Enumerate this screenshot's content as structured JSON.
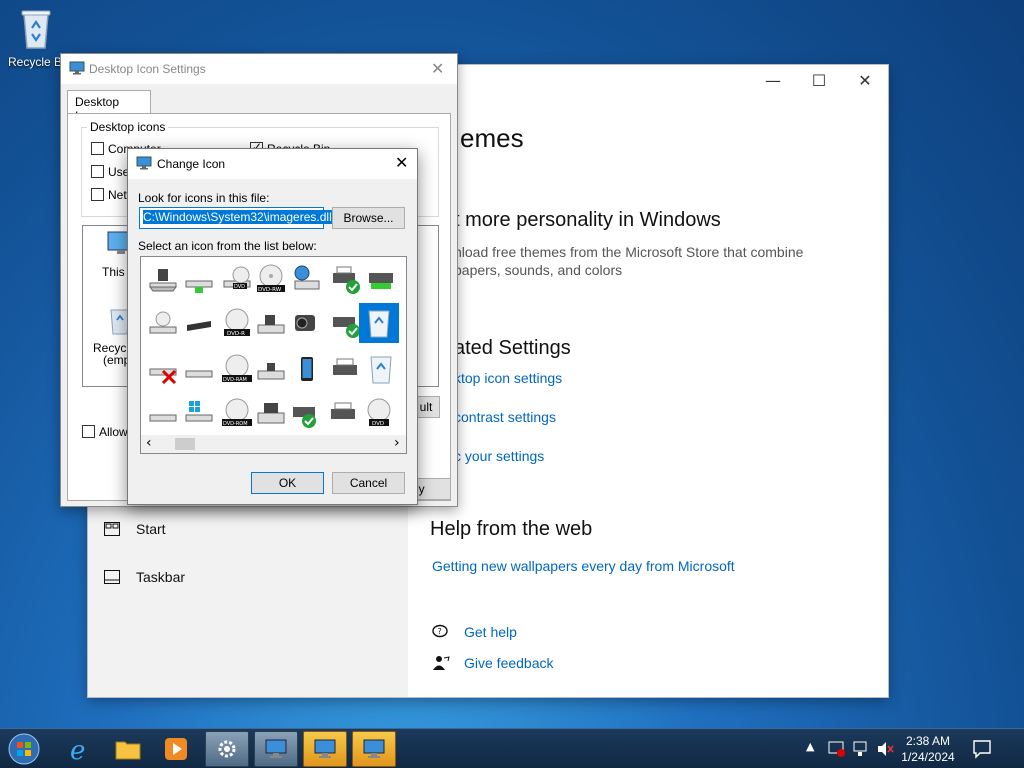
{
  "desktop": {
    "recycle_bin_label": "Recycle Bin"
  },
  "settings": {
    "title_partial": "emes",
    "section1_title": "t more personality in Windows",
    "section1_desc_line1": "nload free themes from the Microsoft Store that combine",
    "section1_desc_line2": "papers, sounds, and colors",
    "related_title": "ated Settings",
    "related_links": [
      "ktop icon settings",
      "contrast settings",
      "c your settings"
    ],
    "help_title": "Help from the web",
    "help_link": "Getting new wallpapers every day from Microsoft",
    "get_help": "Get help",
    "give_feedback": "Give feedback",
    "nav_start": "Start",
    "nav_taskbar": "Taskbar",
    "caption": {
      "minimize": "—",
      "maximize": "☐",
      "close": "✕"
    }
  },
  "desktop_icon_settings": {
    "title": "Desktop Icon Settings",
    "tab": "Desktop Icons",
    "group_label": "Desktop icons",
    "cb_computer": "Computer",
    "cb_user": "User",
    "cb_network": "Netw",
    "cb_recycle": "Recycle Bin",
    "preview_this_pc": "This P",
    "preview_recycle_line1": "Recycle",
    "preview_recycle_line2": "(empt",
    "default_btn": "ult",
    "allow_themes": "Allow t",
    "apply_btn": "ly",
    "close": "✕"
  },
  "change_icon": {
    "title": "Change Icon",
    "look_label": "Look for icons in this file:",
    "path_value": "C:\\Windows\\System32\\imageres.dll",
    "browse_btn": "Browse...",
    "select_label": "Select an icon from the list below:",
    "ok_btn": "OK",
    "cancel_btn": "Cancel",
    "close": "✕",
    "scroll_left": "‹",
    "scroll_right": "›",
    "icon_labels": {
      "dvd": "DVD",
      "dvd_rw": "DVD-RW",
      "dvd_r": "DVD-R",
      "dvd_ram": "DVD-RAM",
      "dvd_rom": "DVD-ROM"
    }
  },
  "taskbar": {
    "time": "2:38 AM",
    "date": "1/24/2024"
  },
  "colors": {
    "accent": "#0078d7",
    "link": "#0067c0",
    "taskbar_active": "#f7c948"
  }
}
